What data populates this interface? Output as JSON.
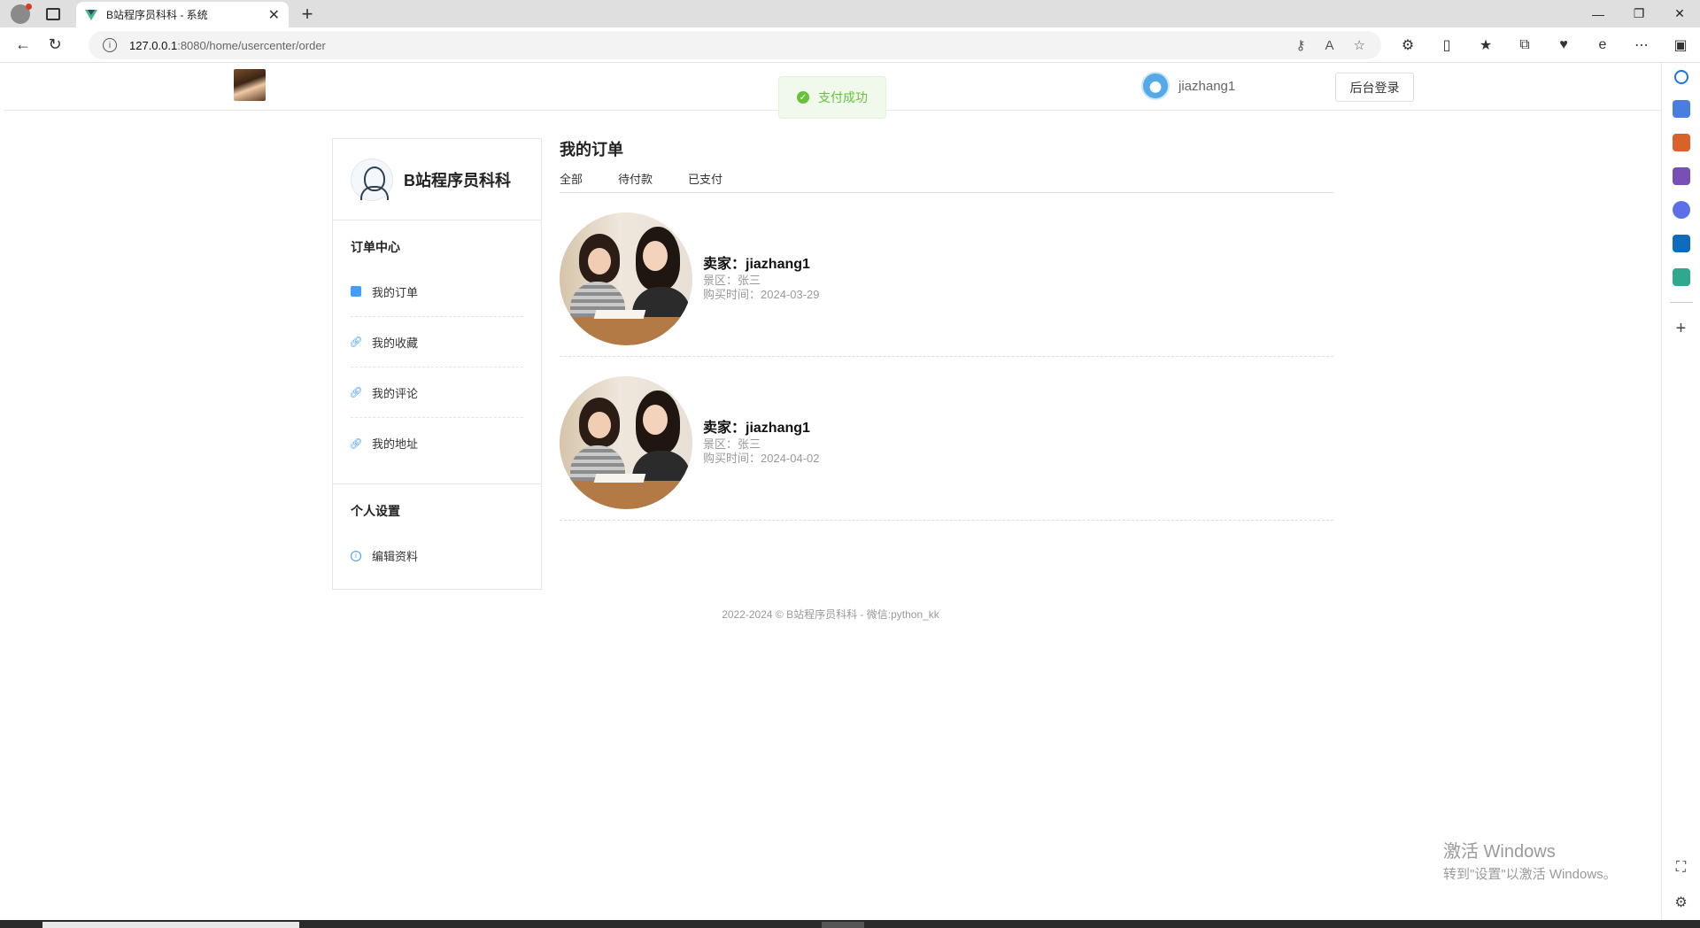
{
  "browser": {
    "tab_title": "B站程序员科科 - 系统",
    "url_host": "127.0.0.1",
    "url_path": ":8080/home/usercenter/order",
    "new_tab": "+",
    "tab_close": "✕",
    "win_minimize": "—",
    "win_restore": "❐",
    "win_close": "✕"
  },
  "header": {
    "username": "jiazhang1",
    "admin_login": "后台登录"
  },
  "toast": {
    "text": "支付成功"
  },
  "sidebar": {
    "brand": "B站程序员科科",
    "order_section": "订单中心",
    "order_items": [
      {
        "label": "我的订单"
      },
      {
        "label": "我的收藏"
      },
      {
        "label": "我的评论"
      },
      {
        "label": "我的地址"
      }
    ],
    "personal_section": "个人设置",
    "personal_items": [
      {
        "label": "编辑资料"
      }
    ]
  },
  "main": {
    "title": "我的订单",
    "tabs": [
      "全部",
      "待付款",
      "已支付"
    ],
    "orders": [
      {
        "seller": "卖家：jiazhang1",
        "area": "景区：张三",
        "time": "购买时间：2024-03-29"
      },
      {
        "seller": "卖家：jiazhang1",
        "area": "景区：张三",
        "time": "购买时间：2024-04-02"
      }
    ]
  },
  "footer": {
    "text": "2022-2024 © B站程序员科科 - 微信:python_kk"
  },
  "watermark": {
    "line1": "激活 Windows",
    "line2": "转到\"设置\"以激活 Windows。"
  }
}
